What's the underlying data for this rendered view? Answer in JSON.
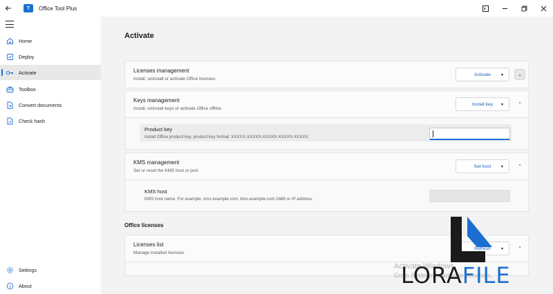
{
  "titlebar": {
    "app_title": "Office Tool Plus",
    "app_icon_label": "T"
  },
  "sidebar": {
    "items": [
      {
        "label": "Home",
        "icon": "home-icon"
      },
      {
        "label": "Deploy",
        "icon": "deploy-icon"
      },
      {
        "label": "Activate",
        "icon": "key-icon",
        "active": true
      },
      {
        "label": "Toolbox",
        "icon": "toolbox-icon"
      },
      {
        "label": "Convert documents",
        "icon": "convert-document-icon"
      },
      {
        "label": "Check hash",
        "icon": "check-hash-icon"
      }
    ],
    "footer": [
      {
        "label": "Settings",
        "icon": "gear-icon"
      },
      {
        "label": "About",
        "icon": "info-icon"
      }
    ]
  },
  "page": {
    "title": "Activate"
  },
  "licenses_management": {
    "title": "Licenses management",
    "description": "Install, uninstall or activate Office licenses.",
    "action_label": "Activate"
  },
  "keys_management": {
    "title": "Keys management",
    "description": "Install, uninstall keys or activate Office offline.",
    "action_label": "Install key",
    "product_key": {
      "title": "Product key",
      "description": "Install Office product key, product key format: XXXXX-XXXXX-XXXXX-XXXXX-XXXXX.",
      "value": ""
    }
  },
  "kms_management": {
    "title": "KMS management",
    "description": "Set or reset the KMS host or port.",
    "action_label": "Set host",
    "kms_host": {
      "title": "KMS host",
      "description": "KMS host name. For example, kms.example.com, kms.example.com:1688 or IP address.",
      "value": ""
    }
  },
  "office_licenses": {
    "section_title": "Office licenses",
    "licenses_list": {
      "title": "Licenses list",
      "description": "Manage installed licenses.",
      "action_label": "Refresh"
    }
  },
  "watermark": {
    "windows_line1": "Activate Windows",
    "windows_line2": "Go to Settings to activate Windows.",
    "logo_part1": "LORA",
    "logo_part2": "FILE"
  },
  "colors": {
    "accent": "#1c6fd1",
    "sidebar_bg": "#ffffff",
    "content_bg": "#f3f3f3"
  }
}
